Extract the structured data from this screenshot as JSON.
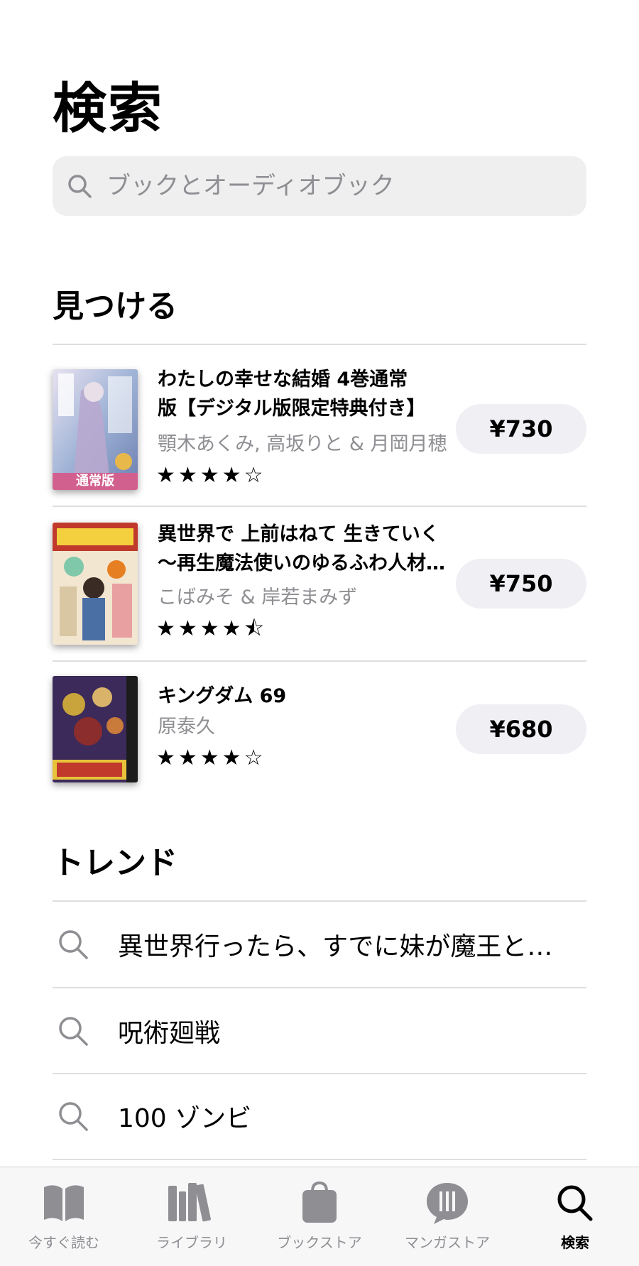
{
  "header": {
    "title": "検索"
  },
  "search": {
    "placeholder": "ブックとオーディオブック"
  },
  "discover": {
    "heading": "見つける",
    "books": [
      {
        "title_line1": "わたしの幸せな結婚 4巻通常",
        "title_line2": "版【デジタル版限定特典付き】",
        "author": "顎木あくみ, 高坂りと & 月岡月穂",
        "stars": "★★★★☆",
        "rating": 4,
        "price": "¥730",
        "cover_badge": "通常版",
        "cover_colors": [
          "#d9d3e6",
          "#8fa7c9",
          "#c88ab0"
        ]
      },
      {
        "title_line1": "異世界で 上前はねて 生きていく",
        "title_line2": "〜再生魔法使いのゆるふわ人材…",
        "author": "こばみそ & 岸若まみず",
        "stars": "★★★★⯪",
        "rating": 4.5,
        "price": "¥750",
        "cover_colors": [
          "#f2e6d0",
          "#c0392b",
          "#4a6fa5"
        ]
      },
      {
        "title_line1": "キングダム 69",
        "title_line2": "",
        "author": "原泰久",
        "stars": "★★★★☆",
        "rating": 4,
        "price": "¥680",
        "cover_colors": [
          "#3b2a5a",
          "#c9a33b",
          "#8b2d2d"
        ]
      }
    ]
  },
  "trend": {
    "heading": "トレンド",
    "items": [
      {
        "label": "異世界行ったら、すでに妹が魔王と…"
      },
      {
        "label": "呪術廻戦"
      },
      {
        "label": "100 ゾンビ"
      }
    ]
  },
  "tabs": [
    {
      "label": "今すぐ読む",
      "icon": "open-book-icon",
      "active": false
    },
    {
      "label": "ライブラリ",
      "icon": "books-stack-icon",
      "active": false
    },
    {
      "label": "ブックストア",
      "icon": "shopping-bag-icon",
      "active": false
    },
    {
      "label": "マンガストア",
      "icon": "manga-bubble-icon",
      "active": false
    },
    {
      "label": "検索",
      "icon": "search-icon",
      "active": true
    }
  ],
  "colors": {
    "accent": "#000000",
    "secondary_text": "#8e8e93",
    "pill_bg": "#efeff4",
    "search_bg": "#efeff0",
    "tab_inactive": "#8e8e93"
  }
}
